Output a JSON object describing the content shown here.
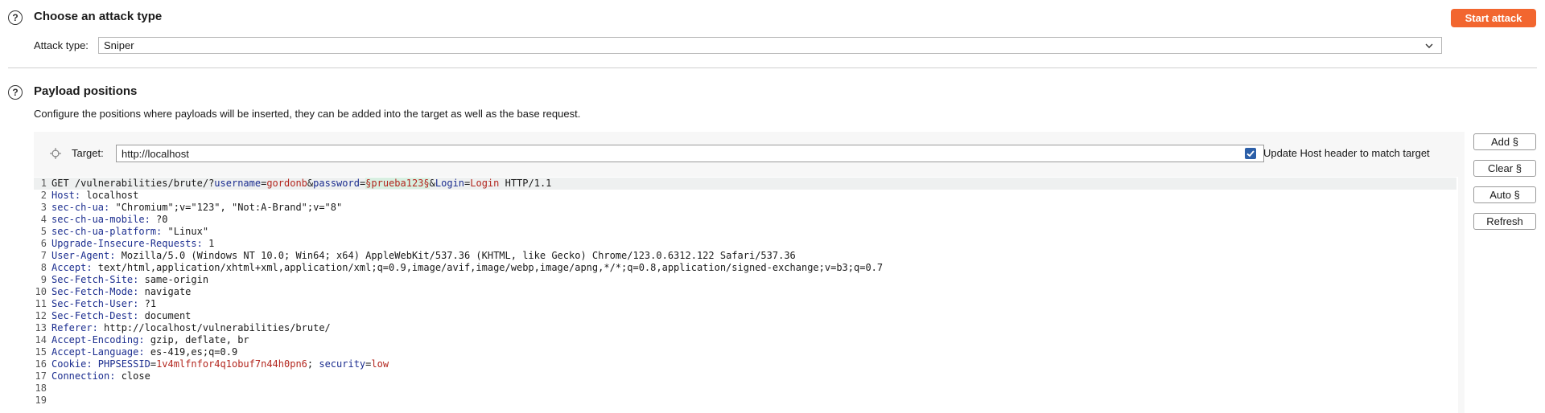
{
  "attack_section": {
    "title": "Choose an attack type",
    "start_button": "Start attack",
    "attack_type_label": "Attack type:",
    "attack_type_value": "Sniper"
  },
  "payload_section": {
    "title": "Payload positions",
    "description": "Configure the positions where payloads will be inserted, they can be added into the target as well as the base request.",
    "target_label": "Target:",
    "target_value": "http://localhost",
    "update_host_label": "Update Host header to match target",
    "update_host_checked": true,
    "buttons": {
      "add": "Add §",
      "clear": "Clear §",
      "auto": "Auto §",
      "refresh": "Refresh"
    }
  },
  "request": {
    "line_numbers": [
      "1",
      "2",
      "3",
      "4",
      "5",
      "6",
      "7",
      "8",
      "9",
      "10",
      "11",
      "12",
      "13",
      "14",
      "15",
      "16",
      "17",
      "18",
      "19"
    ],
    "line1": {
      "method_path": "GET /vulnerabilities/brute/?",
      "p1_name": "username",
      "eq1": "=",
      "p1_value": "gordonb",
      "amp1": "&",
      "p2_name": "password",
      "eq2": "=",
      "p2_value": "§prueba123§",
      "amp2": "&",
      "p3_name": "Login",
      "eq3": "=",
      "p3_value": "Login",
      "version": " HTTP/1.1"
    },
    "headers": [
      {
        "name": "Host:",
        "value": " localhost"
      },
      {
        "name": "sec-ch-ua:",
        "value": " \"Chromium\";v=\"123\", \"Not:A-Brand\";v=\"8\""
      },
      {
        "name": "sec-ch-ua-mobile:",
        "value": " ?0"
      },
      {
        "name": "sec-ch-ua-platform:",
        "value": " \"Linux\""
      },
      {
        "name": "Upgrade-Insecure-Requests:",
        "value": " 1"
      },
      {
        "name": "User-Agent:",
        "value": " Mozilla/5.0 (Windows NT 10.0; Win64; x64) AppleWebKit/537.36 (KHTML, like Gecko) Chrome/123.0.6312.122 Safari/537.36"
      },
      {
        "name": "Accept:",
        "value": " text/html,application/xhtml+xml,application/xml;q=0.9,image/avif,image/webp,image/apng,*/*;q=0.8,application/signed-exchange;v=b3;q=0.7"
      },
      {
        "name": "Sec-Fetch-Site:",
        "value": " same-origin"
      },
      {
        "name": "Sec-Fetch-Mode:",
        "value": " navigate"
      },
      {
        "name": "Sec-Fetch-User:",
        "value": " ?1"
      },
      {
        "name": "Sec-Fetch-Dest:",
        "value": " document"
      },
      {
        "name": "Referer:",
        "value": " http://localhost/vulnerabilities/brute/"
      },
      {
        "name": "Accept-Encoding:",
        "value": " gzip, deflate, br"
      },
      {
        "name": "Accept-Language:",
        "value": " es-419,es;q=0.9"
      }
    ],
    "cookie": {
      "name": "Cookie:",
      "c1_name": " PHPSESSID",
      "eq1": "=",
      "c1_value": "1v4mlfnfor4q1obuf7n44h0pn6",
      "sep": "; ",
      "c2_name": "security",
      "eq2": "=",
      "c2_value": "low"
    },
    "connection": {
      "name": "Connection:",
      "value": " close"
    }
  },
  "colors": {
    "accent": "#f2662f",
    "checkbox": "#2c5fa8",
    "header_name": "#1b2d8f",
    "param_value": "#b3261e"
  }
}
